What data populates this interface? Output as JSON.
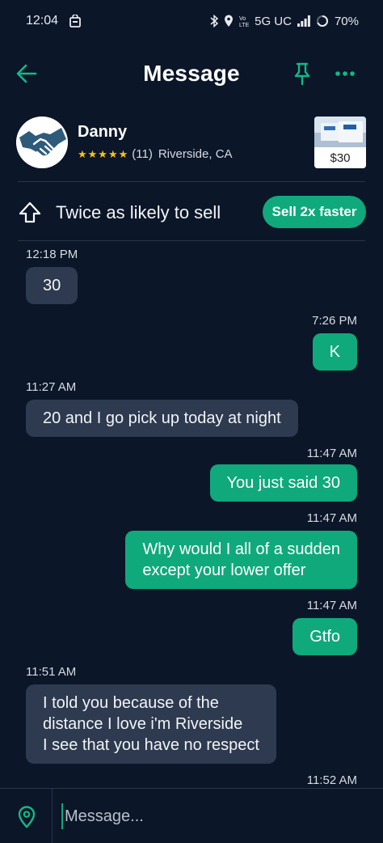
{
  "status_bar": {
    "time": "12:04",
    "network": "5G UC",
    "battery": "70%"
  },
  "header": {
    "title": "Message"
  },
  "seller": {
    "name": "Danny",
    "rating_count": "(11)",
    "location": "Riverside, CA",
    "listing_price": "$30"
  },
  "promo": {
    "text": "Twice as likely to sell",
    "button_label": "Sell 2x faster"
  },
  "messages": [
    {
      "time": "12:18 PM",
      "from": "them",
      "text": "30"
    },
    {
      "time": "7:26 PM",
      "from": "me",
      "text": "K"
    },
    {
      "time": "11:27 AM",
      "from": "them",
      "text": "20 and I go pick up today at night"
    },
    {
      "time": "11:47 AM",
      "from": "me",
      "text": "You just said 30"
    },
    {
      "time": "11:47 AM",
      "from": "me",
      "text": "Why would I all of a sudden\nexcept your lower offer"
    },
    {
      "time": "11:47 AM",
      "from": "me",
      "text": "Gtfo"
    },
    {
      "time": "11:51 AM",
      "from": "them",
      "text": "I told you because of the\ndistance I love i'm Riverside\nI see that you have no respect"
    },
    {
      "time": "11:52 AM",
      "from": "me",
      "text": ""
    }
  ],
  "composer": {
    "placeholder": "Message..."
  },
  "colors": {
    "background": "#0b1628",
    "accent": "#0fa97c",
    "incoming_bubble": "#2d3a4f",
    "star": "#f5c518"
  }
}
